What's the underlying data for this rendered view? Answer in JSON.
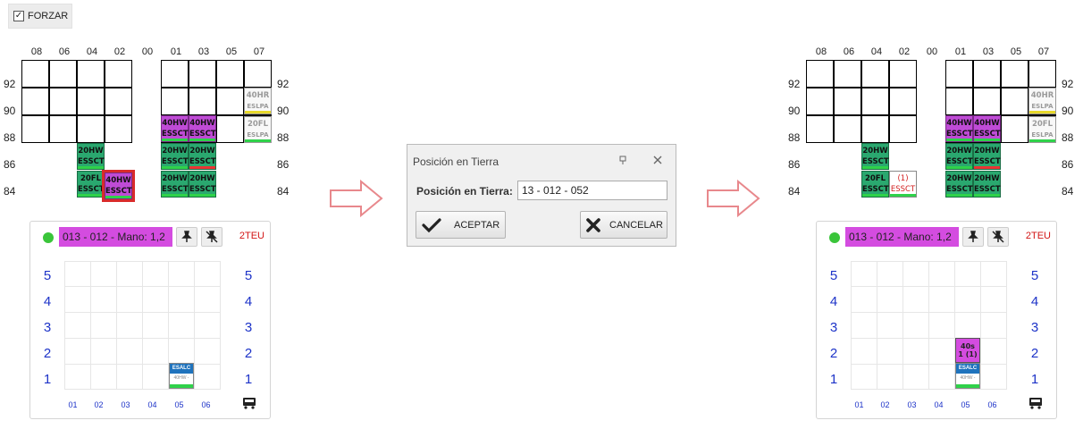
{
  "forzar": {
    "label": "FORZAR",
    "checked": true,
    "check_glyph": "✓"
  },
  "bay": {
    "column_labels": [
      "08",
      "06",
      "04",
      "02",
      "00",
      "01",
      "03",
      "05",
      "07"
    ],
    "row_labels": [
      "92",
      "90",
      "88",
      "86",
      "84"
    ]
  },
  "left_panel": {
    "containers": [
      {
        "type": "40HR",
        "port": "ESLPA",
        "style": "white",
        "stripe": "yellow"
      },
      {
        "type": "20FL",
        "port": "ESLPA",
        "style": "white",
        "stripe": "green"
      },
      {
        "type": "40HW",
        "port": "ESSCT",
        "style": "purple",
        "stripe": "green"
      },
      {
        "type": "40HW",
        "port": "ESSCT",
        "style": "purple",
        "stripe": "green"
      },
      {
        "type": "20HW",
        "port": "ESSCT",
        "style": "green",
        "stripe": "green"
      },
      {
        "type": "20HW",
        "port": "ESSCT",
        "style": "green",
        "stripe": "red"
      },
      {
        "type": "20HW",
        "port": "ESSCT",
        "style": "green",
        "stripe": "green"
      },
      {
        "type": "20HW",
        "port": "ESSCT",
        "style": "green",
        "stripe": "green"
      },
      {
        "type": "20HW",
        "port": "ESSCT",
        "style": "green",
        "stripe": "green"
      },
      {
        "type": "20FL",
        "port": "ESSCT",
        "style": "green",
        "stripe": "green"
      },
      {
        "type": "40HW",
        "port": "ESSCT",
        "style": "purple",
        "stripe": "green",
        "selected": true
      }
    ],
    "stack": {
      "label": "013 - 012 - Mano: 1,2",
      "teu": "2TEU",
      "tiers": [
        "5",
        "4",
        "3",
        "2",
        "1"
      ],
      "rows": [
        "01",
        "02",
        "03",
        "04",
        "05",
        "06"
      ],
      "container": {
        "top": "ESALC",
        "mid": "40HW - ESH"
      }
    }
  },
  "right_panel": {
    "containers": [
      {
        "type": "40HR",
        "port": "ESLPA",
        "style": "white",
        "stripe": "yellow"
      },
      {
        "type": "20FL",
        "port": "ESLPA",
        "style": "white",
        "stripe": "green"
      },
      {
        "type": "40HW",
        "port": "ESSCT",
        "style": "purple",
        "stripe": "green"
      },
      {
        "type": "40HW",
        "port": "ESSCT",
        "style": "purple",
        "stripe": "green"
      },
      {
        "type": "20HW",
        "port": "ESSCT",
        "style": "green",
        "stripe": "green"
      },
      {
        "type": "20HW",
        "port": "ESSCT",
        "style": "green",
        "stripe": "red"
      },
      {
        "type": "20HW",
        "port": "ESSCT",
        "style": "green",
        "stripe": "green"
      },
      {
        "type": "20HW",
        "port": "ESSCT",
        "style": "green",
        "stripe": "green"
      },
      {
        "type": "20HW",
        "port": "ESSCT",
        "style": "green",
        "stripe": "green"
      },
      {
        "type": "20FL",
        "port": "ESSCT",
        "style": "green",
        "stripe": "green"
      },
      {
        "type": "(1)",
        "port": "ESSCT",
        "style": "red",
        "stripe": "green"
      }
    ],
    "stack": {
      "label": "013 - 012 - Mano: 1,2",
      "teu": "2TEU",
      "tiers": [
        "5",
        "4",
        "3",
        "2",
        "1"
      ],
      "rows": [
        "01",
        "02",
        "03",
        "04",
        "05",
        "06"
      ],
      "ghost": {
        "line1": "40s",
        "line2": "1 (1)"
      },
      "container": {
        "top": "ESALC",
        "mid": "40HW - ESH"
      }
    }
  },
  "dialog": {
    "title": "Posición en Tierra",
    "field_label": "Posición en Tierra:",
    "field_value": "13 - 012 - 052",
    "accept_label": "ACEPTAR",
    "cancel_label": "CANCELAR"
  },
  "colors": {
    "purple": "#bf4bd6",
    "green": "#2aa86f",
    "label_bg": "#d44ce0",
    "blue_text": "#1d33c8",
    "red_text": "#d21414",
    "arrow": "#e8888c"
  }
}
